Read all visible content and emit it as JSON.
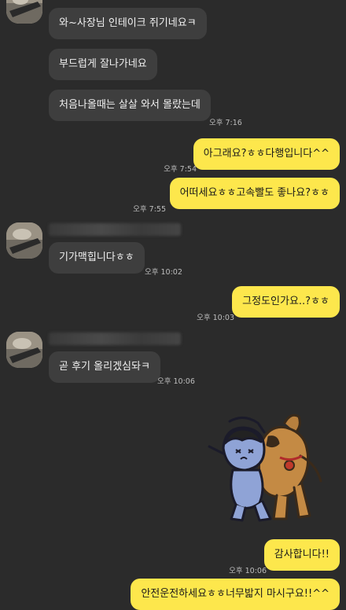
{
  "conversation": {
    "received": [
      {
        "text": "와~사장님 인테이크 쥐기네요ㅋ"
      },
      {
        "text": "부드럽게 잘나가네요"
      },
      {
        "text": "처음나올때는 살살 와서 몰랐는데",
        "time": "오후 7:16"
      },
      {
        "text": "기가맥힙니다ㅎㅎ",
        "time": "오후 10:02"
      },
      {
        "text": "곧 후기 올리겠심돠ㅋ",
        "time": "오후 10:06"
      }
    ],
    "sent": [
      {
        "text": "아그래요?ㅎㅎ다행입니다^^",
        "time": "오후 7:54"
      },
      {
        "text": "어떠세요ㅎㅎ고속빨도 좋나요?ㅎㅎ",
        "time": "오후 7:55"
      },
      {
        "text": "그정도인가요..?ㅎㅎ",
        "time": "오후 10:03"
      },
      {
        "text": "감사합니다!!",
        "time": "오후 10:06"
      },
      {
        "text": "안전운전하세요ㅎㅎ너무밟지 마시구요!!^^"
      }
    ]
  },
  "sticker": {
    "icon": "dancing-characters-sticker"
  },
  "colors": {
    "background": "#2b2b2b",
    "received_bubble": "#3e3e3e",
    "sent_bubble": "#fde74c"
  }
}
